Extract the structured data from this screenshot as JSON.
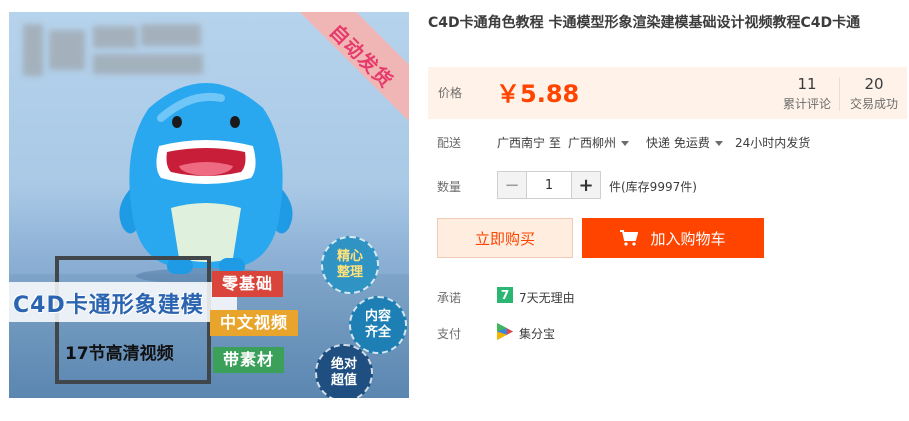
{
  "image": {
    "ribbon_text": "自动发货",
    "title_main": "C4D卡通形象建模",
    "title_sub": "17节高清视频",
    "tags": [
      "零基础",
      "中文视频",
      "带素材"
    ],
    "badges": [
      "精心\n整理",
      "内容\n齐全",
      "绝对\n超值"
    ],
    "colors": {
      "tag_red": "#d9453b",
      "tag_yellow": "#e9a42c",
      "tag_green": "#3aa05a",
      "mascot": "#2aa8ef"
    }
  },
  "product": {
    "title": "C4D卡通角色教程 卡通模型形象渲染建模基础设计视频教程C4D卡通"
  },
  "price": {
    "label": "价格",
    "value": "￥5.88",
    "reviews_count": "11",
    "reviews_label": "累计评论",
    "sales_count": "20",
    "sales_label": "交易成功"
  },
  "delivery": {
    "label": "配送",
    "from": "广西南宁 至",
    "to": "广西柳州",
    "shipping": "快递 免运费",
    "dispatch": "24小时内发货"
  },
  "quantity": {
    "label": "数量",
    "value": "1",
    "stock": "件(库存9997件)"
  },
  "actions": {
    "buy_now": "立即购买",
    "add_to_cart": "加入购物车"
  },
  "promise": {
    "label": "承诺",
    "icon_char": "7",
    "text": "7天无理由"
  },
  "payment": {
    "label": "支付",
    "text": "集分宝"
  },
  "colors": {
    "accent": "#ff4400",
    "price_bg": "#fff2e8",
    "promise_green": "#2bb673"
  }
}
